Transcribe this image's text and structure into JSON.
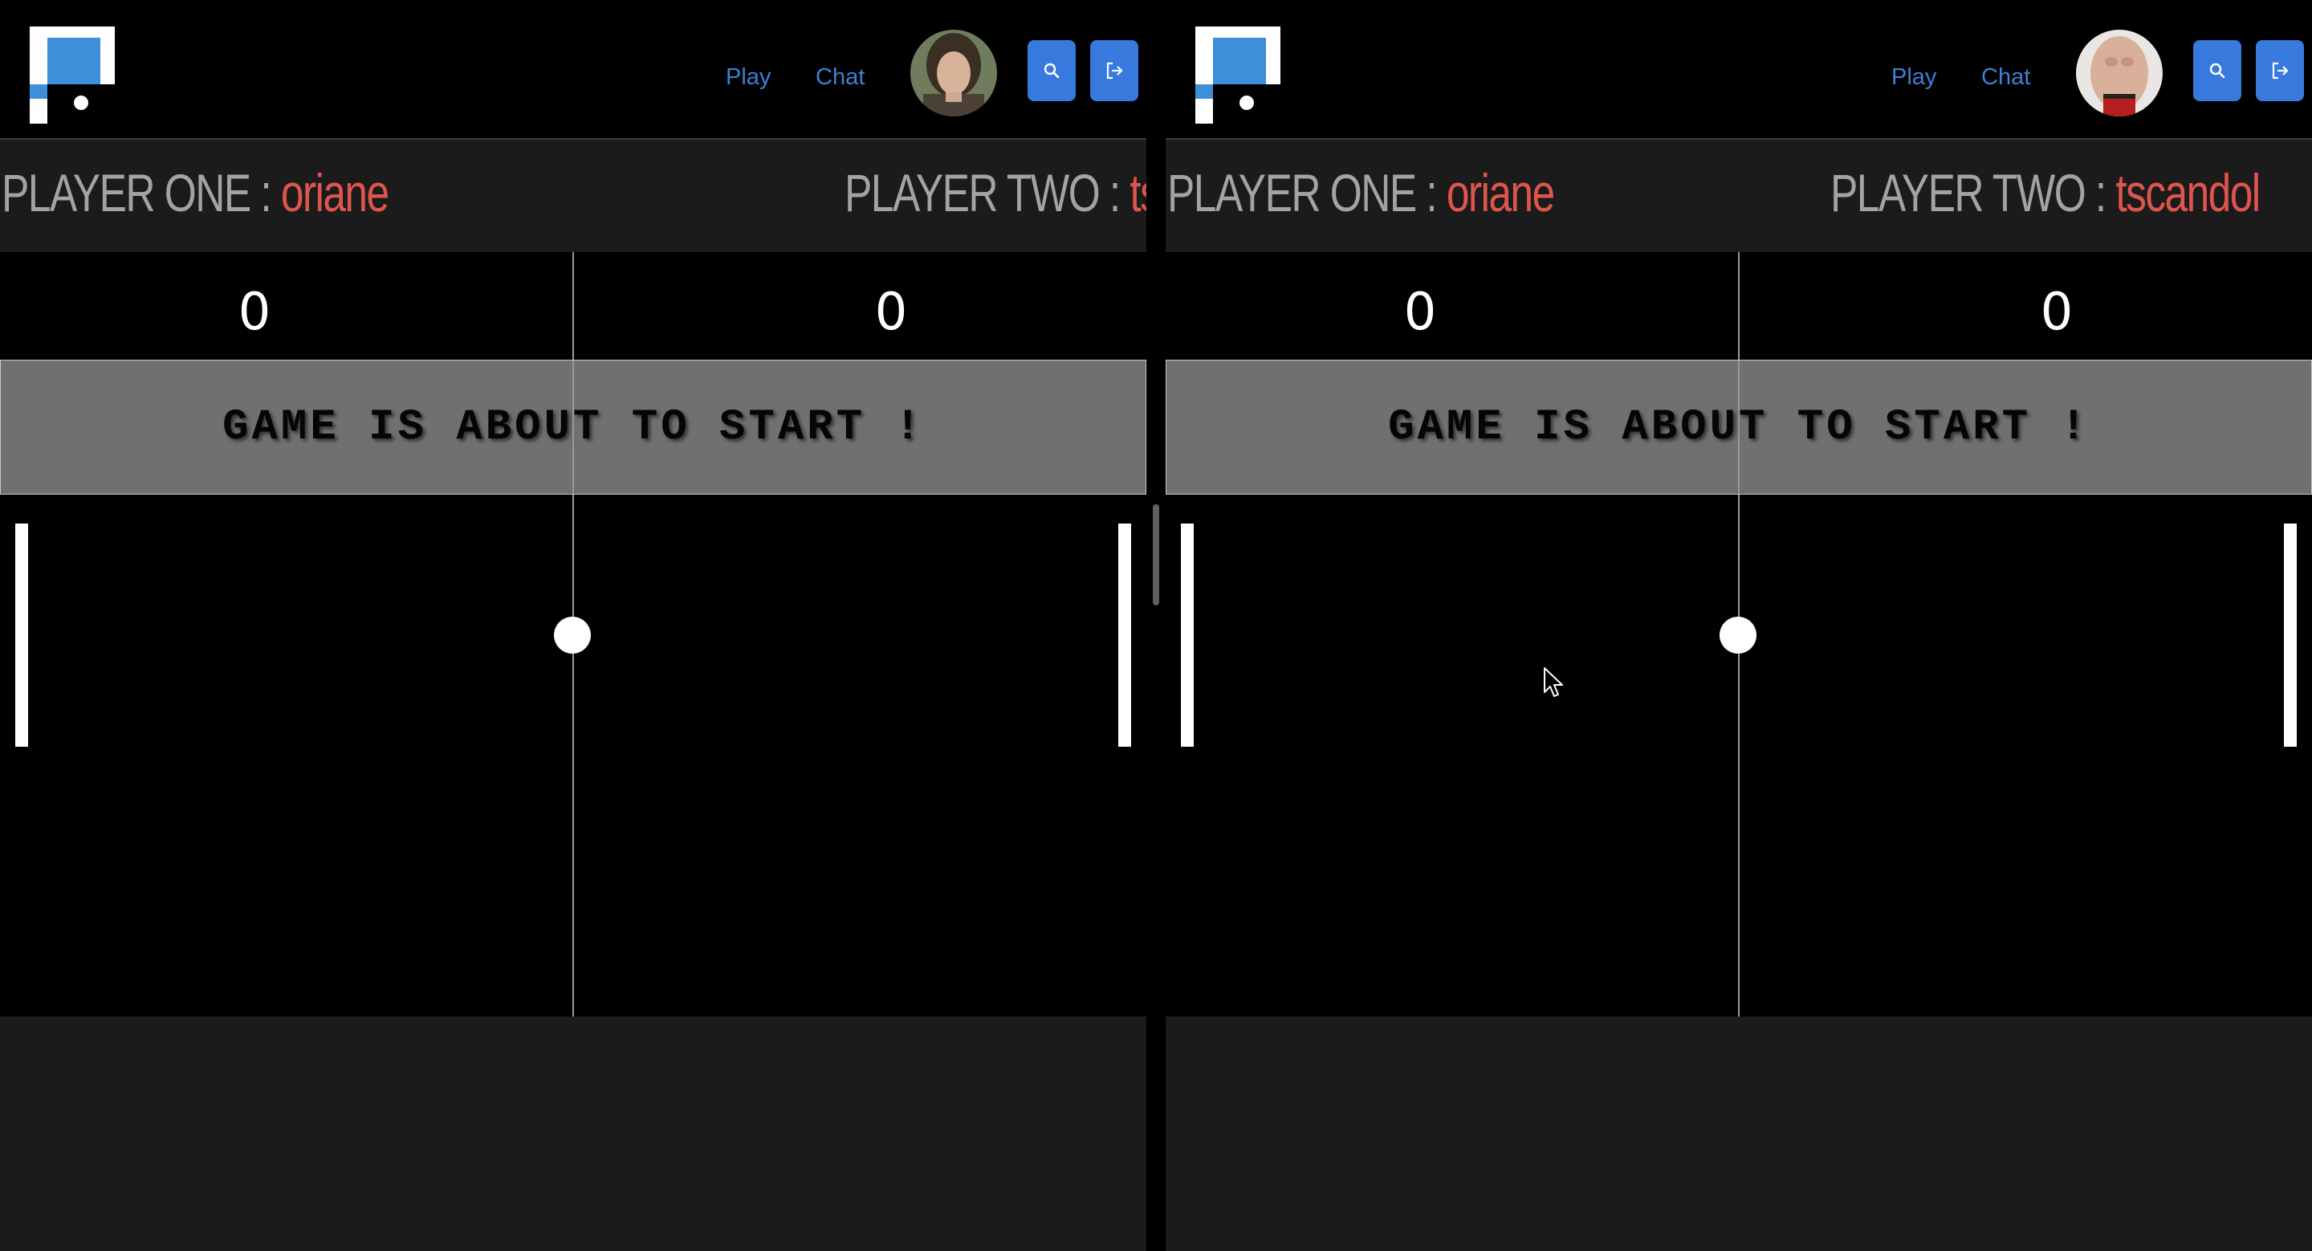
{
  "windows": [
    {
      "nav": {
        "play_label": "Play",
        "chat_label": "Chat"
      },
      "players": {
        "one_label": "PLAYER ONE : ",
        "one_name": "oriane",
        "two_label": "PLAYER TWO : ",
        "two_name": "tscandol"
      },
      "score": {
        "left": "0",
        "right": "0"
      },
      "banner": "GAME IS ABOUT TO START !"
    },
    {
      "nav": {
        "play_label": "Play",
        "chat_label": "Chat"
      },
      "players": {
        "one_label": "PLAYER ONE : ",
        "one_name": "oriane",
        "two_label": "PLAYER TWO : ",
        "two_name": "tscandol"
      },
      "score": {
        "left": "0",
        "right": "0"
      },
      "banner": "GAME IS ABOUT TO START !"
    }
  ],
  "icons": {
    "logo": "app-logo",
    "search": "search-icon",
    "logout": "logout-icon",
    "cursor": "mouse-cursor-icon"
  },
  "colors": {
    "accent": "#3779dc",
    "link": "#3f7fd6",
    "player_name": "#de554e",
    "label": "#a3a3a3"
  }
}
